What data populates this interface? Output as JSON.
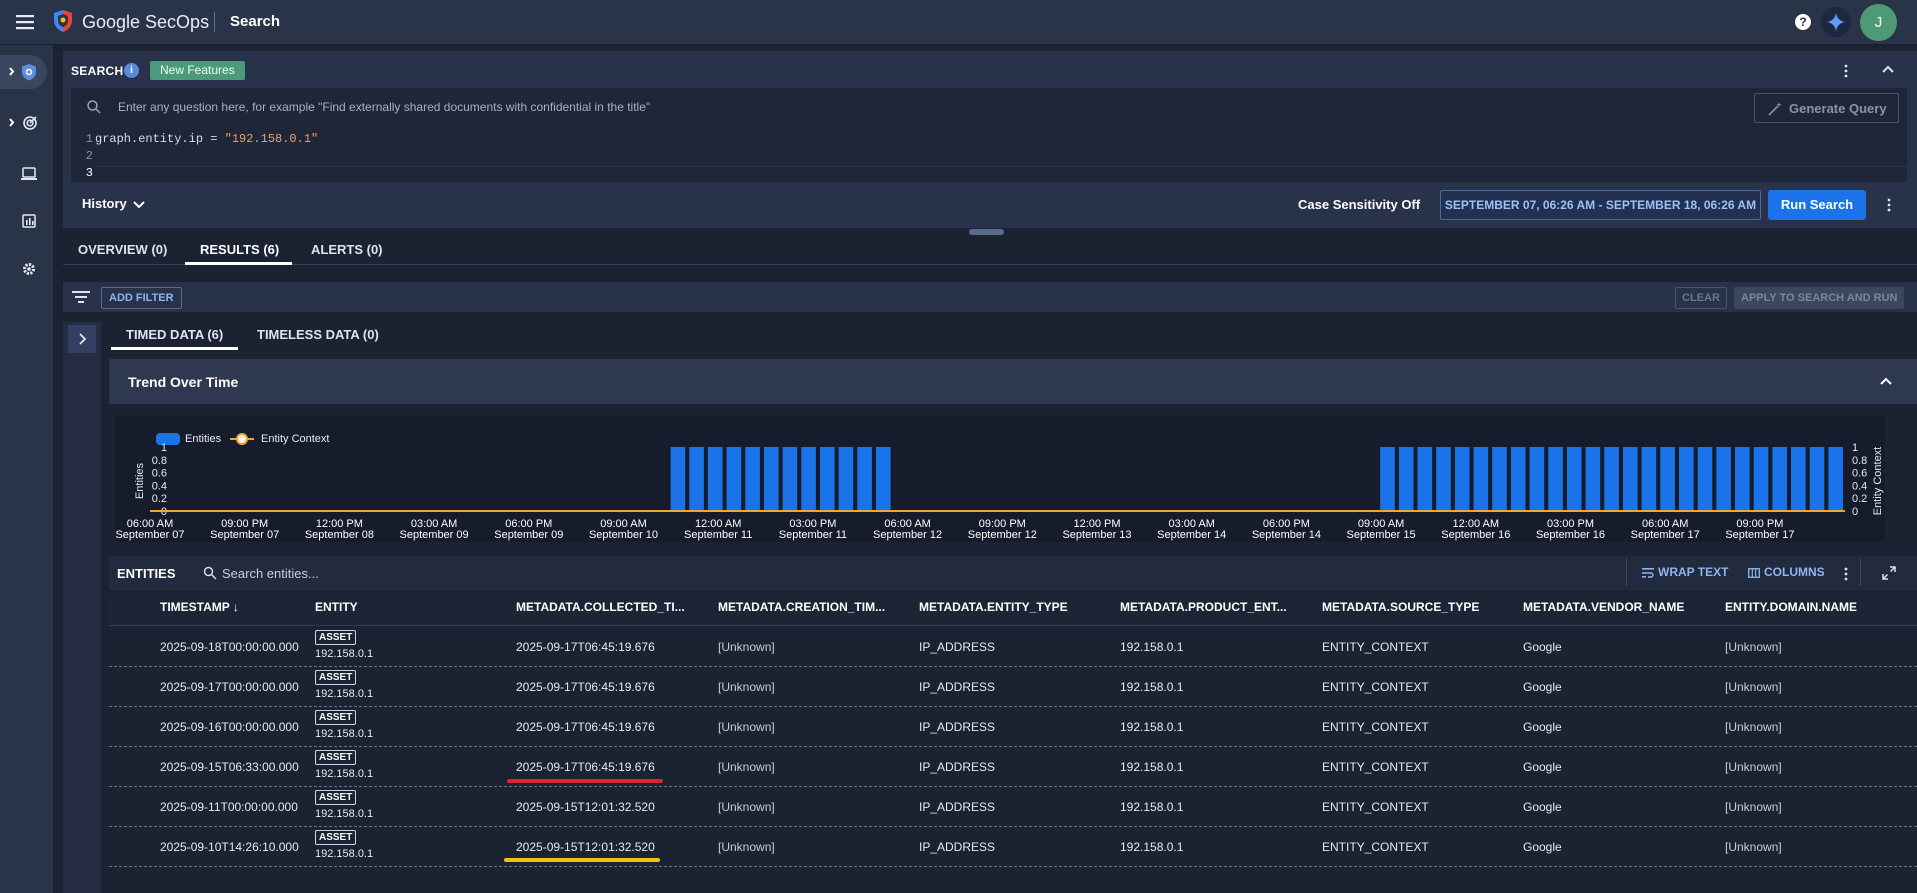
{
  "app": {
    "brand": "Google SecOps",
    "page_title": "Search",
    "avatar_initial": "J",
    "help_label": "?"
  },
  "search": {
    "label": "SEARCH",
    "info_label": "i",
    "new_features": "New Features",
    "nl_placeholder": "Enter any question here, for example \"Find externally shared documents with confidential in the title\"",
    "generate_query": "Generate Query",
    "code_lines": [
      {
        "num": "1",
        "prefix": "graph.entity.ip = ",
        "str": "\"192.158.0.1\""
      },
      {
        "num": "2",
        "prefix": "",
        "str": ""
      },
      {
        "num": "3",
        "prefix": "",
        "str": ""
      }
    ],
    "history": "History",
    "case_sensitivity": "Case Sensitivity Off",
    "date_range": "SEPTEMBER 07, 06:26 AM - SEPTEMBER 18, 06:26 AM",
    "run_search": "Run Search"
  },
  "tabs": [
    {
      "label": "OVERVIEW (0)",
      "active": false
    },
    {
      "label": "RESULTS (6)",
      "active": true
    },
    {
      "label": "ALERTS (0)",
      "active": false
    }
  ],
  "filters": {
    "add_filter": "ADD FILTER",
    "clear": "CLEAR",
    "apply": "APPLY TO SEARCH AND RUN"
  },
  "subtabs": [
    {
      "label": "TIMED DATA (6)",
      "active": true
    },
    {
      "label": "TIMELESS DATA (0)",
      "active": false
    }
  ],
  "trend": {
    "title": "Trend Over Time"
  },
  "chart_data": {
    "type": "bar",
    "title": "",
    "ylabel": "Entities",
    "y2label": "Entity Context",
    "ylim": [
      0,
      1
    ],
    "yticks": [
      "0",
      "0.2",
      "0.4",
      "0.6",
      "0.8",
      "1"
    ],
    "legend_position": "top-left",
    "series": [
      {
        "name": "Entities",
        "color": "#1a73e8",
        "type": "bar",
        "values": [
          0,
          0,
          0,
          0,
          0,
          0,
          0,
          0,
          0,
          0,
          0,
          0,
          0,
          0,
          0,
          0,
          0,
          0,
          0,
          0,
          0,
          0,
          0,
          0,
          0,
          0,
          1,
          1,
          1,
          1,
          1,
          1,
          1,
          1,
          1,
          1,
          1,
          1,
          0,
          0,
          0,
          0,
          0,
          0,
          0,
          0,
          0,
          0,
          0,
          0,
          0,
          0,
          0,
          0,
          0,
          0,
          0,
          0,
          0,
          0,
          0,
          0,
          0,
          0,
          1,
          1,
          1,
          1,
          1,
          1,
          1,
          1,
          1,
          1,
          1,
          1,
          1,
          1,
          1,
          1,
          1,
          1,
          1,
          1,
          1,
          1,
          1,
          1,
          1
        ]
      },
      {
        "name": "Entity Context",
        "color": "#f0a53a",
        "type": "line",
        "values": "all 0"
      }
    ],
    "x_ticks": [
      [
        "06:00 AM",
        "September 07"
      ],
      [
        "09:00 PM",
        "September 07"
      ],
      [
        "12:00 PM",
        "September 08"
      ],
      [
        "03:00 AM",
        "September 09"
      ],
      [
        "06:00 PM",
        "September 09"
      ],
      [
        "09:00 AM",
        "September 10"
      ],
      [
        "12:00 AM",
        "September 11"
      ],
      [
        "03:00 PM",
        "September 11"
      ],
      [
        "06:00 AM",
        "September 12"
      ],
      [
        "09:00 PM",
        "September 12"
      ],
      [
        "12:00 PM",
        "September 13"
      ],
      [
        "03:00 AM",
        "September 14"
      ],
      [
        "06:00 PM",
        "September 14"
      ],
      [
        "09:00 AM",
        "September 15"
      ],
      [
        "12:00 AM",
        "September 16"
      ],
      [
        "03:00 PM",
        "September 16"
      ],
      [
        "06:00 AM",
        "September 17"
      ],
      [
        "09:00 PM",
        "September 17"
      ]
    ]
  },
  "entities": {
    "label": "ENTITIES",
    "search_placeholder": "Search entities...",
    "wrap_text": "WRAP TEXT",
    "columns": "COLUMNS",
    "headers": [
      "TIMESTAMP ↓",
      "ENTITY",
      "METADATA.COLLECTED_TI...",
      "METADATA.CREATION_TIM...",
      "METADATA.ENTITY_TYPE",
      "METADATA.PRODUCT_ENT...",
      "METADATA.SOURCE_TYPE",
      "METADATA.VENDOR_NAME",
      "ENTITY.DOMAIN.NAME"
    ],
    "rows": [
      {
        "timestamp": "2025-09-18T00:00:00.000",
        "badge": "ASSET",
        "entity": "192.158.0.1",
        "collected": "2025-09-17T06:45:19.676",
        "creation": "[Unknown]",
        "entity_type": "IP_ADDRESS",
        "product": "192.158.0.1",
        "source": "ENTITY_CONTEXT",
        "vendor": "Google",
        "domain": "[Unknown]"
      },
      {
        "timestamp": "2025-09-17T00:00:00.000",
        "badge": "ASSET",
        "entity": "192.158.0.1",
        "collected": "2025-09-17T06:45:19.676",
        "creation": "[Unknown]",
        "entity_type": "IP_ADDRESS",
        "product": "192.158.0.1",
        "source": "ENTITY_CONTEXT",
        "vendor": "Google",
        "domain": "[Unknown]"
      },
      {
        "timestamp": "2025-09-16T00:00:00.000",
        "badge": "ASSET",
        "entity": "192.158.0.1",
        "collected": "2025-09-17T06:45:19.676",
        "creation": "[Unknown]",
        "entity_type": "IP_ADDRESS",
        "product": "192.158.0.1",
        "source": "ENTITY_CONTEXT",
        "vendor": "Google",
        "domain": "[Unknown]"
      },
      {
        "timestamp": "2025-09-15T06:33:00.000",
        "badge": "ASSET",
        "entity": "192.158.0.1",
        "collected": "2025-09-17T06:45:19.676",
        "creation": "[Unknown]",
        "entity_type": "IP_ADDRESS",
        "product": "192.158.0.1",
        "source": "ENTITY_CONTEXT",
        "vendor": "Google",
        "domain": "[Unknown]"
      },
      {
        "timestamp": "2025-09-11T00:00:00.000",
        "badge": "ASSET",
        "entity": "192.158.0.1",
        "collected": "2025-09-15T12:01:32.520",
        "creation": "[Unknown]",
        "entity_type": "IP_ADDRESS",
        "product": "192.158.0.1",
        "source": "ENTITY_CONTEXT",
        "vendor": "Google",
        "domain": "[Unknown]"
      },
      {
        "timestamp": "2025-09-10T14:26:10.000",
        "badge": "ASSET",
        "entity": "192.158.0.1",
        "collected": "2025-09-15T12:01:32.520",
        "creation": "[Unknown]",
        "entity_type": "IP_ADDRESS",
        "product": "192.158.0.1",
        "source": "ENTITY_CONTEXT",
        "vendor": "Google",
        "domain": "[Unknown]"
      }
    ]
  },
  "colors": {
    "accent": "#1a73e8",
    "bar": "#1a73e8",
    "line": "#f0a53a",
    "badge_green": "#4b9a7c",
    "highlight_red": "#d9252e",
    "highlight_yellow": "#f2c20f"
  }
}
